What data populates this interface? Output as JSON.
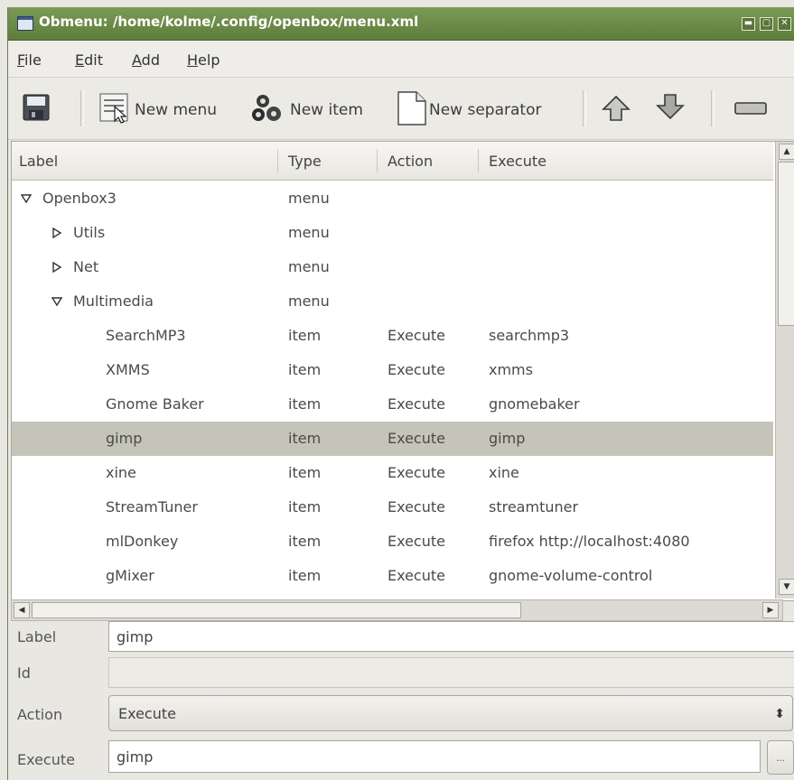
{
  "window": {
    "title": "Obmenu: /home/kolme/.config/openbox/menu.xml",
    "controls": [
      "minimize",
      "maximize",
      "close"
    ]
  },
  "menubar": {
    "items": [
      {
        "pre": "",
        "ul": "F",
        "post": "ile"
      },
      {
        "pre": "",
        "ul": "E",
        "post": "dit"
      },
      {
        "pre": "",
        "ul": "A",
        "post": "dd"
      },
      {
        "pre": "",
        "ul": "H",
        "post": "elp"
      }
    ]
  },
  "toolbar": {
    "save_icon": "floppy-disk-icon",
    "new_menu_label": "New menu",
    "new_item_label": "New item",
    "new_separator_label": "New separator",
    "move_up_icon": "arrow-up-icon",
    "move_down_icon": "arrow-down-icon",
    "remove_icon": "remove-icon"
  },
  "tree": {
    "columns": [
      "Label",
      "Type",
      "Action",
      "Execute"
    ],
    "rows": [
      {
        "label": "Openbox3",
        "type": "menu",
        "action": "",
        "execute": "",
        "depth": 0,
        "expander": "expanded"
      },
      {
        "label": "Utils",
        "type": "menu",
        "action": "",
        "execute": "",
        "depth": 1,
        "expander": "collapsed"
      },
      {
        "label": "Net",
        "type": "menu",
        "action": "",
        "execute": "",
        "depth": 1,
        "expander": "collapsed"
      },
      {
        "label": "Multimedia",
        "type": "menu",
        "action": "",
        "execute": "",
        "depth": 1,
        "expander": "expanded"
      },
      {
        "label": "SearchMP3",
        "type": "item",
        "action": "Execute",
        "execute": "searchmp3",
        "depth": 2,
        "expander": "none"
      },
      {
        "label": "XMMS",
        "type": "item",
        "action": "Execute",
        "execute": "xmms",
        "depth": 2,
        "expander": "none"
      },
      {
        "label": "Gnome Baker",
        "type": "item",
        "action": "Execute",
        "execute": "gnomebaker",
        "depth": 2,
        "expander": "none"
      },
      {
        "label": "gimp",
        "type": "item",
        "action": "Execute",
        "execute": "gimp",
        "depth": 2,
        "expander": "none",
        "selected": true
      },
      {
        "label": "xine",
        "type": "item",
        "action": "Execute",
        "execute": "xine",
        "depth": 2,
        "expander": "none"
      },
      {
        "label": "StreamTuner",
        "type": "item",
        "action": "Execute",
        "execute": "streamtuner",
        "depth": 2,
        "expander": "none"
      },
      {
        "label": "mlDonkey",
        "type": "item",
        "action": "Execute",
        "execute": "firefox http://localhost:4080",
        "depth": 2,
        "expander": "none"
      },
      {
        "label": "gMixer",
        "type": "item",
        "action": "Execute",
        "execute": "gnome-volume-control",
        "depth": 2,
        "expander": "none"
      }
    ]
  },
  "form": {
    "label_caption": "Label",
    "label_value": "gimp",
    "id_caption": "Id",
    "id_value": "",
    "action_caption": "Action",
    "action_value": "Execute",
    "execute_caption": "Execute",
    "execute_value": "gimp",
    "browse_label": "..."
  },
  "colors": {
    "titlebar": "#6b8a48",
    "selection": "#c5c4b8"
  }
}
